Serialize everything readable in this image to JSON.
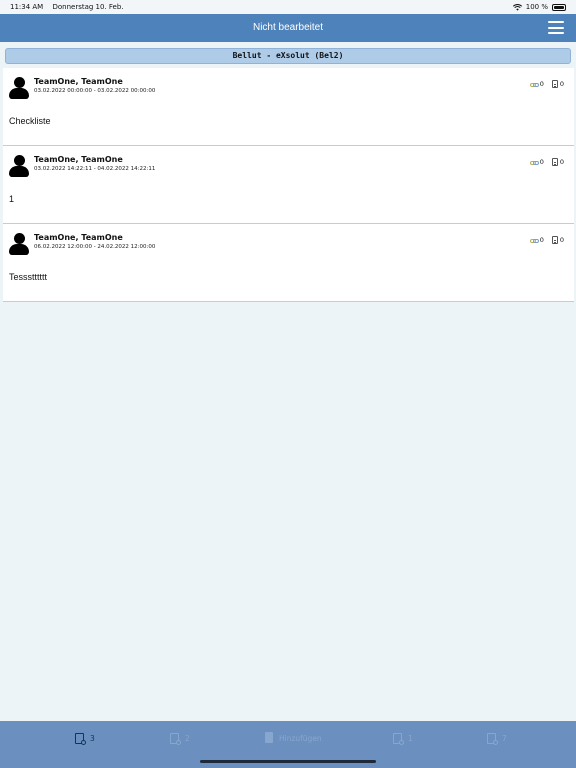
{
  "status_bar": {
    "time": "11:34 AM",
    "date": "Donnerstag 10. Feb.",
    "battery": "100 %",
    "wifi_icon": "wifi-icon",
    "battery_icon": "battery-icon"
  },
  "nav": {
    "title": "Nicht bearbeitet",
    "menu_icon": "hamburger-menu-icon"
  },
  "section": {
    "title": "Bellut - eXsolut (Bel2)"
  },
  "entries": [
    {
      "name": "TeamOne, TeamOne",
      "dates": "03.02.2022 00:00:00 - 03.02.2022 00:00:00",
      "text": "Checkliste",
      "links_count": "0",
      "docs_count": "0"
    },
    {
      "name": "TeamOne, TeamOne",
      "dates": "03.02.2022 14:22:11 - 04.02.2022 14:22:11",
      "text": "1",
      "links_count": "0",
      "docs_count": "0"
    },
    {
      "name": "TeamOne, TeamOne",
      "dates": "06.02.2022 12:00:00 - 24.02.2022 12:00:00",
      "text": "Tessstttttt",
      "links_count": "0",
      "docs_count": "0"
    }
  ],
  "tabs": [
    {
      "label": "3",
      "icon": "clipboard-badge-icon",
      "active": true
    },
    {
      "label": "2",
      "icon": "clipboard-badge-icon",
      "active": false
    },
    {
      "label": "Hinzufügen",
      "icon": "document-add-icon",
      "active": false
    },
    {
      "label": "1",
      "icon": "clipboard-badge-icon",
      "active": false
    },
    {
      "label": "7",
      "icon": "clipboard-badge-icon",
      "active": false
    }
  ],
  "colors": {
    "nav_bar": "#4e82bb",
    "tab_bar": "#6b8fbf",
    "section_header": "#aecbe8",
    "background": "#edf4f8"
  }
}
